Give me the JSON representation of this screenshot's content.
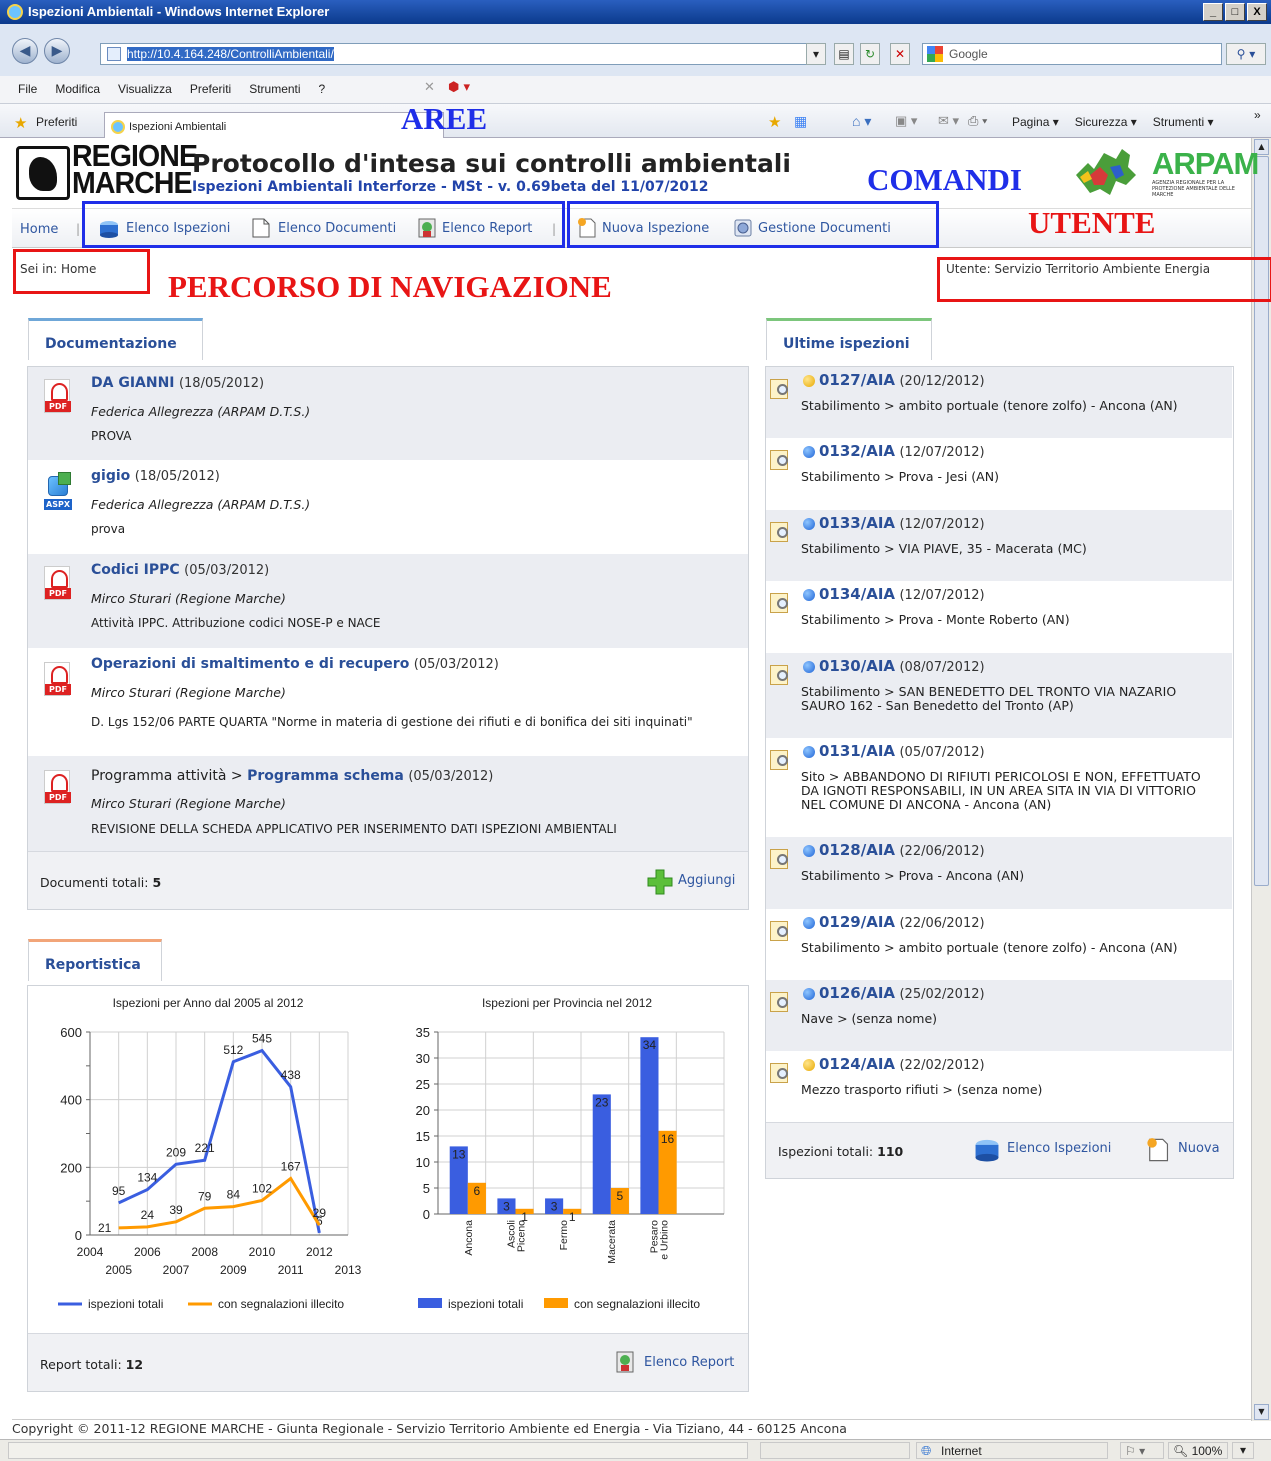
{
  "window": {
    "title": "Ispezioni Ambientali - Windows Internet Explorer",
    "controls": [
      "_",
      "□",
      "X"
    ]
  },
  "browser": {
    "url": "http://10.4.164.248/ControlliAmbientali/",
    "search_placeholder": "Google",
    "menu": [
      "File",
      "Modifica",
      "Visualizza",
      "Preferiti",
      "Strumenti",
      "?"
    ],
    "favorites_label": "Preferiti",
    "tab_title": "Ispezioni Ambientali",
    "commands": [
      "Pagina ▾",
      "Sicurezza ▾",
      "Strumenti ▾"
    ],
    "status_zone": "Internet",
    "zoom": "100%"
  },
  "brand": {
    "logo_line1": "REGIONE",
    "logo_line2": "MARCHE",
    "title": "Protocollo d'intesa sui controlli ambientali",
    "subtitle": "Ispezioni Ambientali Interforze - MSt - v. 0.69beta del 11/07/2012",
    "arpam": "ARPAM",
    "arpam_sub": "AGENZIA REGIONALE PER LA PROTEZIONE AMBIENTALE DELLE MARCHE"
  },
  "nav": {
    "home": "Home",
    "elenco_ispezioni": "Elenco Ispezioni",
    "elenco_documenti": "Elenco Documenti",
    "elenco_report": "Elenco Report",
    "nuova_ispezione": "Nuova Ispezione",
    "gestione_documenti": "Gestione Documenti"
  },
  "annotations": {
    "aree": "AREE",
    "comandi": "COMANDI",
    "utente": "UTENTE",
    "percorso": "PERCORSO DI NAVIGAZIONE"
  },
  "breadcrumb": "Sei in: Home",
  "user": "Utente: Servizio Territorio Ambiente Energia",
  "documentazione": {
    "tab": "Documentazione",
    "items": [
      {
        "prefix": "",
        "title": "DA GIANNI",
        "date": "(18/05/2012)",
        "author": "Federica Allegrezza (ARPAM D.T.S.)",
        "desc": "PROVA",
        "type": "PDF"
      },
      {
        "prefix": "",
        "title": "gigio",
        "date": "(18/05/2012)",
        "author": "Federica Allegrezza (ARPAM D.T.S.)",
        "desc": "prova",
        "type": "ASPX"
      },
      {
        "prefix": "",
        "title": "Codici IPPC",
        "date": "(05/03/2012)",
        "author": "Mirco Sturari (Regione Marche)",
        "desc": "Attività IPPC. Attribuzione codici NOSE-P e NACE",
        "type": "PDF"
      },
      {
        "prefix": "",
        "title": "Operazioni di smaltimento e di recupero",
        "date": "(05/03/2012)",
        "author": "Mirco Sturari (Regione Marche)",
        "desc": "D. Lgs 152/06 PARTE QUARTA \"Norme in materia di gestione dei rifiuti e di bonifica dei siti inquinati\"",
        "type": "PDF"
      },
      {
        "prefix": "Programma attività > ",
        "title": "Programma schema",
        "date": "(05/03/2012)",
        "author": "Mirco Sturari (Regione Marche)",
        "desc": "REVISIONE DELLA SCHEDA APPLICATIVO PER INSERIMENTO DATI ISPEZIONI AMBIENTALI",
        "type": "PDF"
      }
    ],
    "total_label": "Documenti totali:",
    "total": "5",
    "add": "Aggiungi"
  },
  "reportistica": {
    "tab": "Reportistica",
    "total_label": "Report totali:",
    "total": "12",
    "link": "Elenco Report"
  },
  "chart_data": [
    {
      "type": "line",
      "title": "Ispezioni per Anno dal 2005 al 2012",
      "x": [
        2005,
        2006,
        2007,
        2008,
        2009,
        2010,
        2011,
        2012
      ],
      "x_ticks_top": [
        "2004",
        "2006",
        "2008",
        "2010",
        "2012"
      ],
      "x_ticks_bottom": [
        "2005",
        "2007",
        "2009",
        "2011",
        "2013"
      ],
      "xlim": [
        2004,
        2013
      ],
      "ylim": [
        0,
        600
      ],
      "y_ticks": [
        "0",
        "200",
        "400",
        "600"
      ],
      "grid": true,
      "legend": "bottom",
      "series": [
        {
          "name": "ispezioni totali",
          "color": "#3a5ee0",
          "values": [
            95,
            134,
            209,
            221,
            512,
            545,
            438,
            6
          ]
        },
        {
          "name": "con segnalazioni illecito",
          "color": "#ff9a00",
          "values": [
            21,
            24,
            39,
            79,
            84,
            102,
            167,
            29
          ]
        }
      ]
    },
    {
      "type": "bar",
      "title": "Ispezioni per Provincia nel 2012",
      "categories": [
        "Ancona",
        "Ascoli Piceno",
        "Fermo",
        "Macerata",
        "Pesaro e Urbino"
      ],
      "category_lines": [
        [
          "Ancona"
        ],
        [
          "Ascoli",
          "Piceno"
        ],
        [
          "Fermo"
        ],
        [
          "Macerata"
        ],
        [
          "Pesaro",
          "e Urbino"
        ]
      ],
      "ylim": [
        0,
        35
      ],
      "y_ticks": [
        "0",
        "5",
        "10",
        "15",
        "20",
        "25",
        "30",
        "35"
      ],
      "grid": true,
      "legend": "bottom",
      "series": [
        {
          "name": "ispezioni totali",
          "color": "#3a5ee0",
          "values": [
            13,
            3,
            3,
            23,
            34
          ]
        },
        {
          "name": "con segnalazioni illecito",
          "color": "#ff9a00",
          "values": [
            6,
            1,
            1,
            5,
            16
          ]
        }
      ]
    }
  ],
  "ultime_ispezioni": {
    "tab": "Ultime ispezioni",
    "items": [
      {
        "code": "0127/AIA",
        "date": "(20/12/2012)",
        "status": "yellow",
        "desc": "Stabilimento > ambito portuale (tenore zolfo) - Ancona (AN)"
      },
      {
        "code": "0132/AIA",
        "date": "(12/07/2012)",
        "status": "blue",
        "desc": "Stabilimento > Prova - Jesi (AN)"
      },
      {
        "code": "0133/AIA",
        "date": "(12/07/2012)",
        "status": "blue",
        "desc": "Stabilimento > VIA PIAVE, 35 - Macerata (MC)"
      },
      {
        "code": "0134/AIA",
        "date": "(12/07/2012)",
        "status": "blue",
        "desc": "Stabilimento > Prova - Monte Roberto (AN)"
      },
      {
        "code": "0130/AIA",
        "date": "(08/07/2012)",
        "status": "blue",
        "desc": "Stabilimento > SAN BENEDETTO DEL TRONTO VIA NAZARIO SAURO 162 - San Benedetto del Tronto (AP)"
      },
      {
        "code": "0131/AIA",
        "date": "(05/07/2012)",
        "status": "blue",
        "desc": "Sito > ABBANDONO DI RIFIUTI PERICOLOSI E NON, EFFETTUATO DA IGNOTI RESPONSABILI, IN UN AREA SITA IN VIA DI VITTORIO NEL COMUNE DI ANCONA - Ancona (AN)"
      },
      {
        "code": "0128/AIA",
        "date": "(22/06/2012)",
        "status": "blue",
        "desc": "Stabilimento > Prova - Ancona (AN)"
      },
      {
        "code": "0129/AIA",
        "date": "(22/06/2012)",
        "status": "blue",
        "desc": "Stabilimento > ambito portuale (tenore zolfo) - Ancona (AN)"
      },
      {
        "code": "0126/AIA",
        "date": "(25/02/2012)",
        "status": "blue",
        "desc": "Nave > (senza nome)"
      },
      {
        "code": "0124/AIA",
        "date": "(22/02/2012)",
        "status": "yellow",
        "desc": "Mezzo trasporto rifiuti > (senza nome)"
      }
    ],
    "total_label": "Ispezioni totali:",
    "total": "110",
    "link_elenco": "Elenco Ispezioni",
    "link_nuova": "Nuova"
  },
  "footer": "Copyright © 2011-12 REGIONE MARCHE - Giunta Regionale - Servizio Territorio Ambiente ed Energia - Via Tiziano, 44 - 60125 Ancona",
  "colors": {
    "annotation_blue": "#1f2ee8",
    "annotation_red": "#e81515",
    "link": "#2a4f98"
  }
}
